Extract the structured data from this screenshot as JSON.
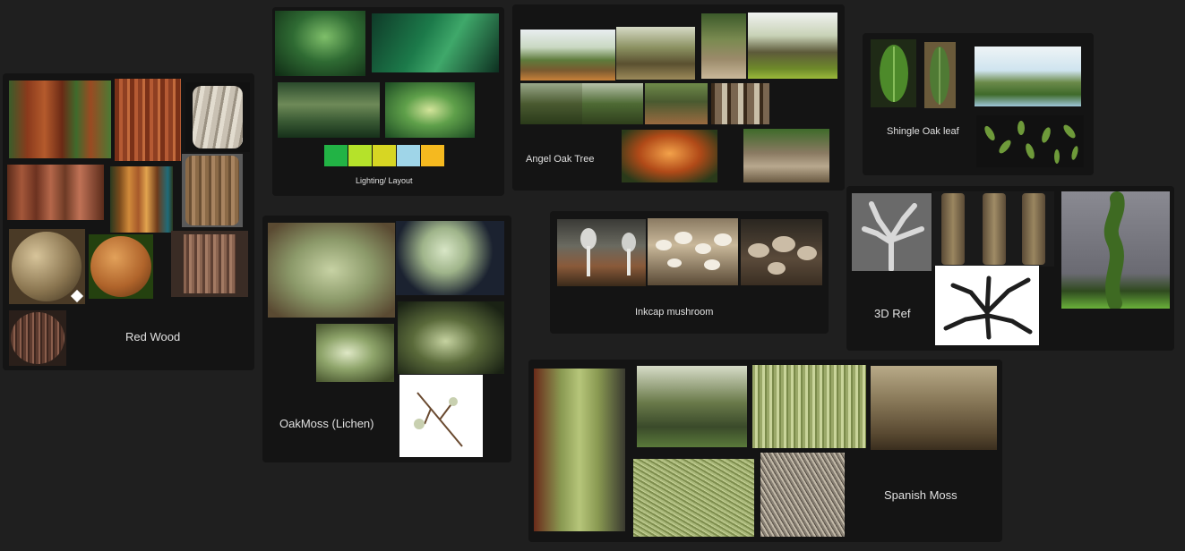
{
  "boards": {
    "red_wood": {
      "label": "Red Wood"
    },
    "lighting": {
      "label": "Lighting/ Layout",
      "palette": [
        "#22b345",
        "#b5e22a",
        "#d7d623",
        "#9fd5e8",
        "#f5b91f"
      ]
    },
    "angel_oak": {
      "label": "Angel Oak Tree"
    },
    "shingle_oak": {
      "label": "Shingle Oak leaf"
    },
    "oakmoss": {
      "label": "OakMoss (Lichen)"
    },
    "inkcap": {
      "label": "Inkcap mushroom"
    },
    "ref3d": {
      "label": "3D Ref"
    },
    "spanish_moss": {
      "label": "Spanish Moss"
    }
  },
  "colors": {
    "canvas": "#1f1f1f",
    "board": "#141414",
    "label": "#e0e0e0"
  }
}
